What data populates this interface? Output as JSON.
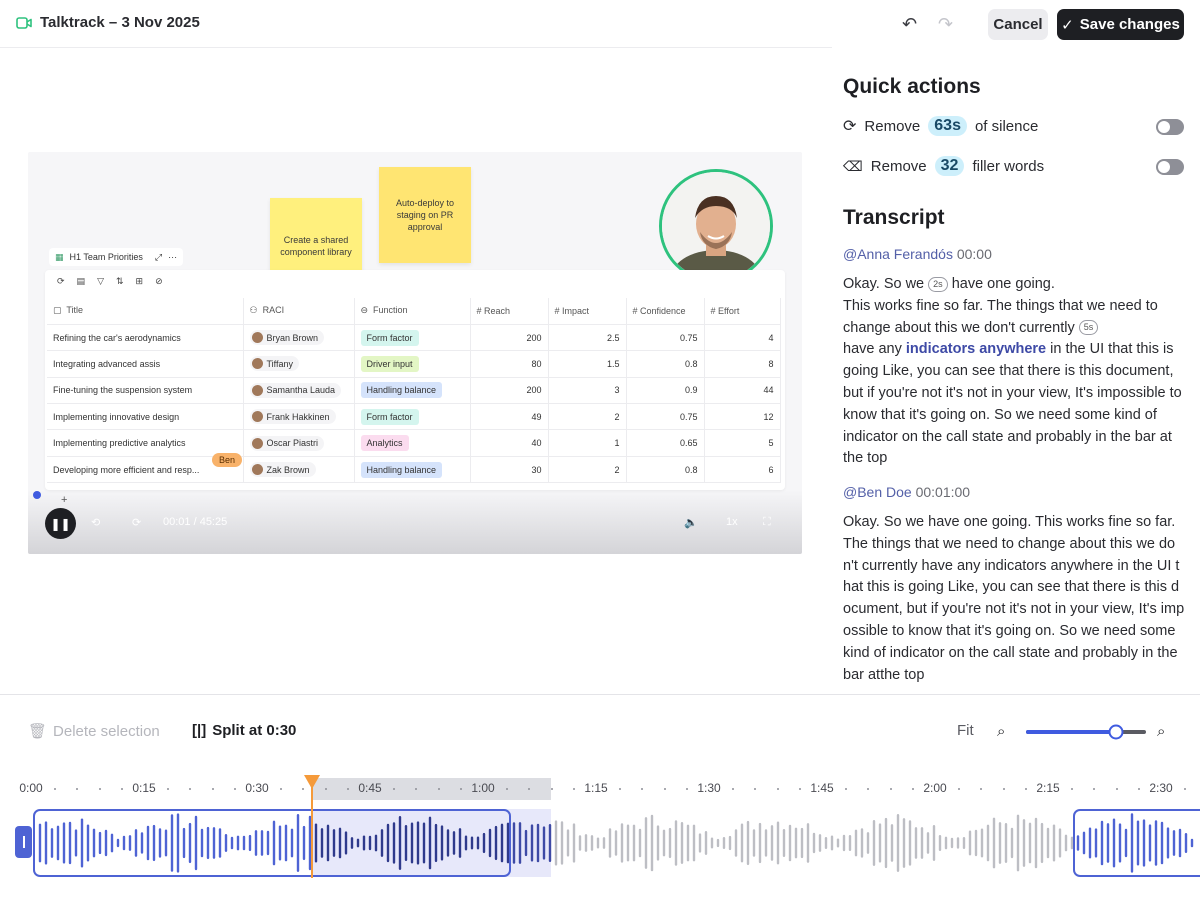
{
  "header": {
    "title": "Talktrack – 3 Nov 2025",
    "undo_icon": "undo-icon",
    "redo_icon": "redo-icon",
    "cancel_label": "Cancel",
    "save_label": "Save changes",
    "save_check": "✓"
  },
  "video": {
    "sticky_notes": [
      "Create a shared component library",
      "Auto-deploy to staging on PR approval"
    ],
    "table_title": "H1 Team Priorities",
    "columns": [
      "Title",
      "RACI",
      "Function",
      "Reach",
      "Impact",
      "Confidence",
      "Effort"
    ],
    "rows": [
      {
        "title": "Refining the car's aerodynamics",
        "raci": "Bryan Brown",
        "function": "Form factor",
        "fcolor": "#d4f5ee",
        "reach": "200",
        "impact": "2.5",
        "confidence": "0.75",
        "effort": "4"
      },
      {
        "title": "Integrating advanced assis",
        "raci": "Tiffany",
        "function": "Driver input",
        "fcolor": "#e3f6c5",
        "reach": "80",
        "impact": "1.5",
        "confidence": "0.8",
        "effort": "8"
      },
      {
        "title": "Fine-tuning the suspension system",
        "raci": "Samantha Lauda",
        "function": "Handling balance",
        "fcolor": "#d5e3fb",
        "reach": "200",
        "impact": "3",
        "confidence": "0.9",
        "effort": "44"
      },
      {
        "title": "Implementing innovative design",
        "raci": "Frank Hakkinen",
        "function": "Form factor",
        "fcolor": "#d4f5ee",
        "reach": "49",
        "impact": "2",
        "confidence": "0.75",
        "effort": "12"
      },
      {
        "title": "Implementing predictive analytics",
        "raci": "Oscar Piastri",
        "function": "Analytics",
        "fcolor": "#fbdcef",
        "reach": "40",
        "impact": "1",
        "confidence": "0.65",
        "effort": "5"
      },
      {
        "title": "Developing more efficient and resp...",
        "raci": "Zak Brown",
        "function": "Handling balance",
        "fcolor": "#d5e3fb",
        "reach": "30",
        "impact": "2",
        "confidence": "0.8",
        "effort": "6"
      }
    ],
    "cursor_name": "Ben",
    "time": "00:01 / 45:25",
    "speed": "1x",
    "add_row": "+"
  },
  "quick_actions": {
    "heading": "Quick actions",
    "silence": {
      "prefix": "Remove",
      "value": "63s",
      "suffix": "of silence"
    },
    "filler": {
      "prefix": "Remove",
      "value": "32",
      "suffix": "filler words"
    }
  },
  "transcript": {
    "heading": "Transcript",
    "entries": [
      {
        "speaker": "@Anna Ferandós",
        "time": "00:00"
      },
      {
        "speaker": "@Ben Doe",
        "time": "00:01:00"
      }
    ],
    "p1_a": "Okay. So we",
    "p1_chip1": "2s",
    "p1_b": "have one going.",
    "p1_c": "This works fine so far. The things that we need to change about this we don't currently",
    "p1_chip2": "5s",
    "p1_d": "have any",
    "p1_hl": "indicators anywhere",
    "p1_e": "in the UI that this is going Like, you can see that there is this document, but if you're not it's not in your view, It's impossible to know that it's going on. So we need some kind of indicator on the call state and probably in the bar at the top",
    "p2": "Okay. So we have one going. This works fine so far. The things that we need to change about this we don't currently have any indicators anywhere in the UI that this is going Like, you can see that there is this document, but if you're not it's not in your view, It's impossible to know that it's going on. So we need some kind of indicator on the call state and probably in the bar atthe top"
  },
  "timeline": {
    "delete_label": "Delete selection",
    "split_label": "Split at 0:30",
    "fit_label": "Fit",
    "zoom_level": 0.75,
    "ticks": [
      "0:00",
      "0:15",
      "0:30",
      "0:45",
      "1:00",
      "1:15",
      "1:30",
      "1:45",
      "2:00",
      "2:15",
      "2:30"
    ],
    "playhead": "0:39"
  }
}
